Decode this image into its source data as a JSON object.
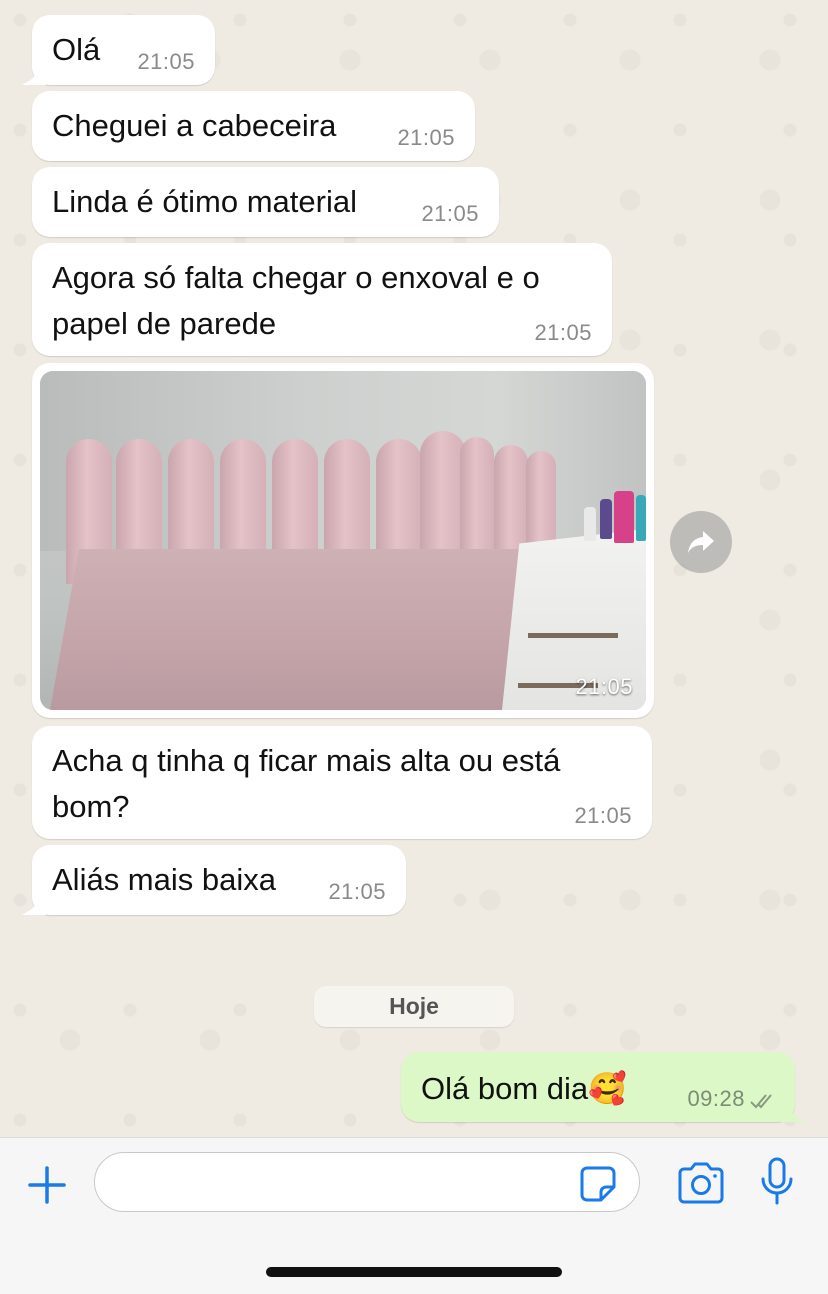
{
  "colors": {
    "chat_background": "#efeae2",
    "incoming_bubble": "#ffffff",
    "outgoing_bubble": "#dbf8c6",
    "accent": "#1a7ae8",
    "timestamp": "#8a8a8a"
  },
  "messages": [
    {
      "text": "Olá",
      "time": "21:05"
    },
    {
      "text": "Cheguei a cabeceira",
      "time": "21:05"
    },
    {
      "text": "Linda é ótimo material",
      "time": "21:05"
    },
    {
      "text": "Agora só falta chegar o enxoval e o papel de parede",
      "time": "21:05"
    },
    {
      "type": "photo",
      "time": "21:05"
    },
    {
      "text": "Acha q tinha q ficar mais alta ou está bom?",
      "time": "21:05"
    },
    {
      "text": "Aliás mais baixa",
      "time": "21:05"
    }
  ],
  "date_separator": "Hoje",
  "outgoing": {
    "text": "Olá bom dia🥰",
    "time": "09:28",
    "status_icon": "double-check-icon"
  },
  "input": {
    "value": "",
    "placeholder": ""
  },
  "icons": [
    "plus-icon",
    "sticker-icon",
    "camera-icon",
    "microphone-icon",
    "forward-icon"
  ]
}
